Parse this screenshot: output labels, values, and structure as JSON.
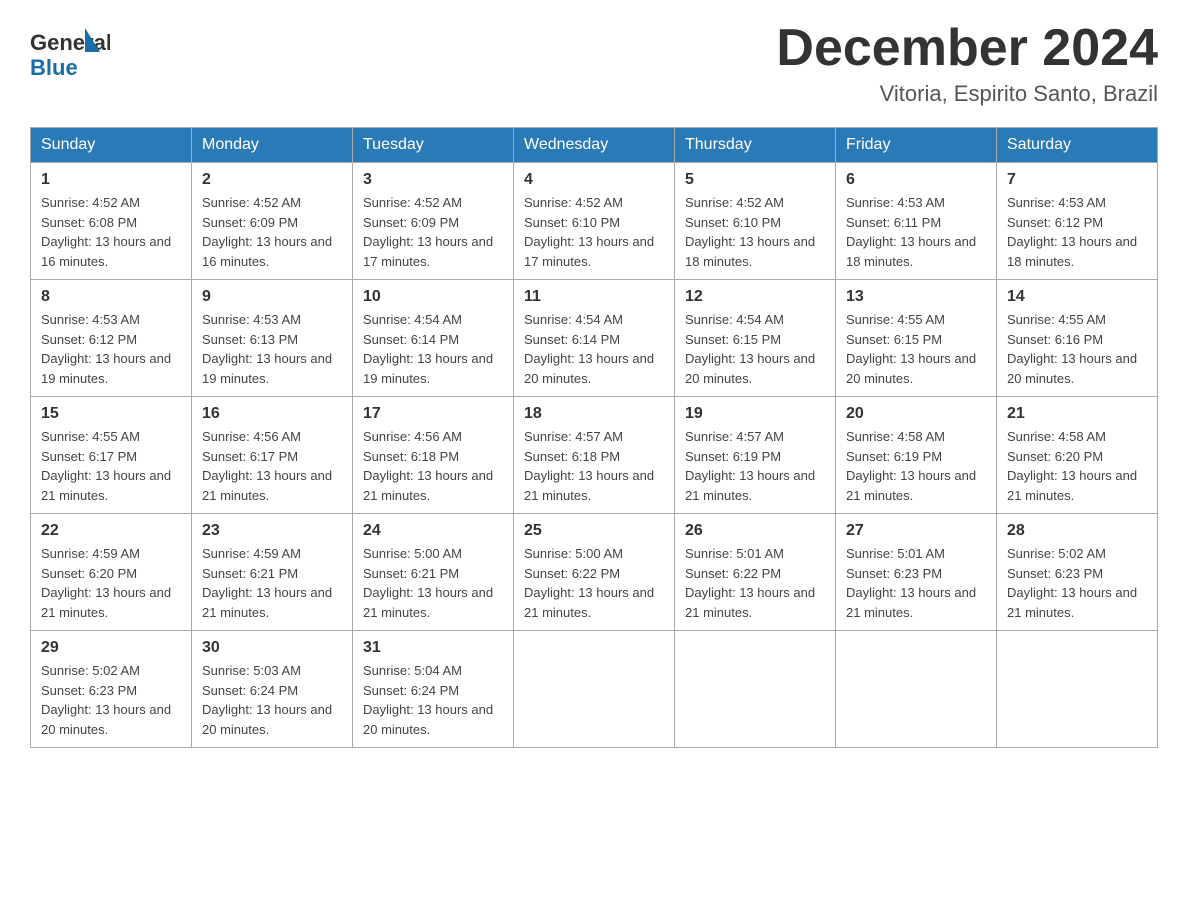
{
  "header": {
    "logo_general": "General",
    "logo_blue": "Blue",
    "title": "December 2024",
    "location": "Vitoria, Espirito Santo, Brazil"
  },
  "calendar": {
    "days_of_week": [
      "Sunday",
      "Monday",
      "Tuesday",
      "Wednesday",
      "Thursday",
      "Friday",
      "Saturday"
    ],
    "weeks": [
      [
        {
          "day": "1",
          "sunrise": "4:52 AM",
          "sunset": "6:08 PM",
          "daylight": "13 hours and 16 minutes."
        },
        {
          "day": "2",
          "sunrise": "4:52 AM",
          "sunset": "6:09 PM",
          "daylight": "13 hours and 16 minutes."
        },
        {
          "day": "3",
          "sunrise": "4:52 AM",
          "sunset": "6:09 PM",
          "daylight": "13 hours and 17 minutes."
        },
        {
          "day": "4",
          "sunrise": "4:52 AM",
          "sunset": "6:10 PM",
          "daylight": "13 hours and 17 minutes."
        },
        {
          "day": "5",
          "sunrise": "4:52 AM",
          "sunset": "6:10 PM",
          "daylight": "13 hours and 18 minutes."
        },
        {
          "day": "6",
          "sunrise": "4:53 AM",
          "sunset": "6:11 PM",
          "daylight": "13 hours and 18 minutes."
        },
        {
          "day": "7",
          "sunrise": "4:53 AM",
          "sunset": "6:12 PM",
          "daylight": "13 hours and 18 minutes."
        }
      ],
      [
        {
          "day": "8",
          "sunrise": "4:53 AM",
          "sunset": "6:12 PM",
          "daylight": "13 hours and 19 minutes."
        },
        {
          "day": "9",
          "sunrise": "4:53 AM",
          "sunset": "6:13 PM",
          "daylight": "13 hours and 19 minutes."
        },
        {
          "day": "10",
          "sunrise": "4:54 AM",
          "sunset": "6:14 PM",
          "daylight": "13 hours and 19 minutes."
        },
        {
          "day": "11",
          "sunrise": "4:54 AM",
          "sunset": "6:14 PM",
          "daylight": "13 hours and 20 minutes."
        },
        {
          "day": "12",
          "sunrise": "4:54 AM",
          "sunset": "6:15 PM",
          "daylight": "13 hours and 20 minutes."
        },
        {
          "day": "13",
          "sunrise": "4:55 AM",
          "sunset": "6:15 PM",
          "daylight": "13 hours and 20 minutes."
        },
        {
          "day": "14",
          "sunrise": "4:55 AM",
          "sunset": "6:16 PM",
          "daylight": "13 hours and 20 minutes."
        }
      ],
      [
        {
          "day": "15",
          "sunrise": "4:55 AM",
          "sunset": "6:17 PM",
          "daylight": "13 hours and 21 minutes."
        },
        {
          "day": "16",
          "sunrise": "4:56 AM",
          "sunset": "6:17 PM",
          "daylight": "13 hours and 21 minutes."
        },
        {
          "day": "17",
          "sunrise": "4:56 AM",
          "sunset": "6:18 PM",
          "daylight": "13 hours and 21 minutes."
        },
        {
          "day": "18",
          "sunrise": "4:57 AM",
          "sunset": "6:18 PM",
          "daylight": "13 hours and 21 minutes."
        },
        {
          "day": "19",
          "sunrise": "4:57 AM",
          "sunset": "6:19 PM",
          "daylight": "13 hours and 21 minutes."
        },
        {
          "day": "20",
          "sunrise": "4:58 AM",
          "sunset": "6:19 PM",
          "daylight": "13 hours and 21 minutes."
        },
        {
          "day": "21",
          "sunrise": "4:58 AM",
          "sunset": "6:20 PM",
          "daylight": "13 hours and 21 minutes."
        }
      ],
      [
        {
          "day": "22",
          "sunrise": "4:59 AM",
          "sunset": "6:20 PM",
          "daylight": "13 hours and 21 minutes."
        },
        {
          "day": "23",
          "sunrise": "4:59 AM",
          "sunset": "6:21 PM",
          "daylight": "13 hours and 21 minutes."
        },
        {
          "day": "24",
          "sunrise": "5:00 AM",
          "sunset": "6:21 PM",
          "daylight": "13 hours and 21 minutes."
        },
        {
          "day": "25",
          "sunrise": "5:00 AM",
          "sunset": "6:22 PM",
          "daylight": "13 hours and 21 minutes."
        },
        {
          "day": "26",
          "sunrise": "5:01 AM",
          "sunset": "6:22 PM",
          "daylight": "13 hours and 21 minutes."
        },
        {
          "day": "27",
          "sunrise": "5:01 AM",
          "sunset": "6:23 PM",
          "daylight": "13 hours and 21 minutes."
        },
        {
          "day": "28",
          "sunrise": "5:02 AM",
          "sunset": "6:23 PM",
          "daylight": "13 hours and 21 minutes."
        }
      ],
      [
        {
          "day": "29",
          "sunrise": "5:02 AM",
          "sunset": "6:23 PM",
          "daylight": "13 hours and 20 minutes."
        },
        {
          "day": "30",
          "sunrise": "5:03 AM",
          "sunset": "6:24 PM",
          "daylight": "13 hours and 20 minutes."
        },
        {
          "day": "31",
          "sunrise": "5:04 AM",
          "sunset": "6:24 PM",
          "daylight": "13 hours and 20 minutes."
        },
        null,
        null,
        null,
        null
      ]
    ]
  }
}
